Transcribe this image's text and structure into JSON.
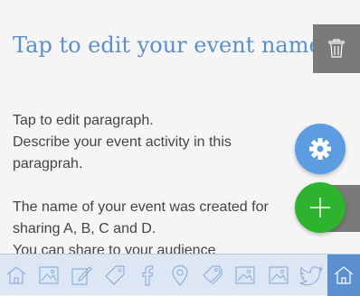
{
  "event": {
    "title": "Tap to edit your event name",
    "paragraph_lines": [
      "Tap to edit paragraph.",
      "Describe your event activity in this",
      "paragprah.",
      "",
      "The name of your event was created for",
      "sharing A, B, C and D.",
      "You can share to your audience"
    ]
  },
  "actions": {
    "delete_icon": "trash-icon",
    "settings_icon": "gear-icon",
    "add_icon": "plus-icon"
  },
  "toolbar": {
    "items": [
      {
        "icon": "home-icon"
      },
      {
        "icon": "image-icon"
      },
      {
        "icon": "edit-icon"
      },
      {
        "icon": "tag-icon"
      },
      {
        "icon": "facebook-icon"
      },
      {
        "icon": "location-pin-icon"
      },
      {
        "icon": "tags-icon"
      },
      {
        "icon": "image-icon"
      },
      {
        "icon": "image-icon"
      },
      {
        "icon": "twitter-icon"
      },
      {
        "icon": "home-icon",
        "active": true
      }
    ]
  },
  "colors": {
    "accent": "#5b8fd0",
    "settings_button": "#5b9de0",
    "add_button": "#2db32d",
    "delete_button": "#7a7a7a"
  }
}
